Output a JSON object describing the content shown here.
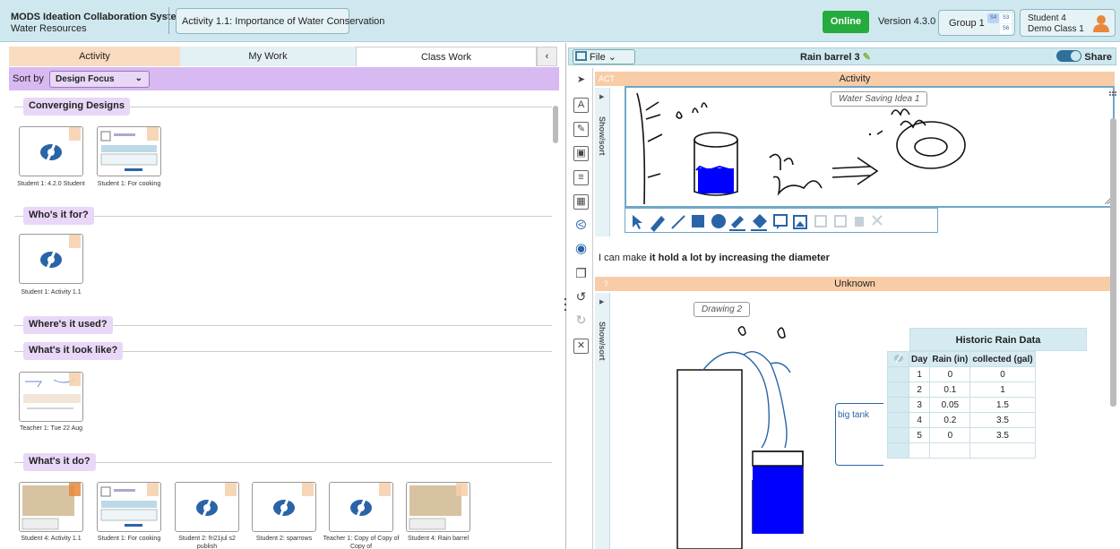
{
  "header": {
    "app_title": "MODS Ideation Collaboration System",
    "app_subtitle": "Water Resources",
    "activity": "Activity 1.1: Importance of Water Conservation",
    "status": "Online",
    "version": "Version 4.3.0",
    "group": "Group 1",
    "group_members": [
      "S4",
      "S3",
      "S6"
    ],
    "user_name": "Student 4",
    "user_class": "Demo Class 1"
  },
  "left": {
    "tabs": [
      "Activity",
      "My Work",
      "Class Work"
    ],
    "collapse": "‹",
    "sort_label": "Sort by",
    "sort_value": "Design Focus",
    "sections": [
      {
        "title": "Converging Designs",
        "items": [
          "Student 1: 4.2.0 Student",
          "Student 1: For cooking"
        ]
      },
      {
        "title": "Who's it for?",
        "items": [
          "Student 1: Activity 1.1"
        ]
      },
      {
        "title": "Where's it used?",
        "items": []
      },
      {
        "title": "What's it look like?",
        "items": [
          "Teacher 1: Tue 22 Aug"
        ]
      },
      {
        "title": "What's it do?",
        "items": [
          "Student 4: Activity 1.1",
          "Student 1: For cooking",
          "Student 2: fri21jul s2 publish",
          "Student 2: sparrows",
          "Teacher 1: Copy of Copy of Copy of",
          "Student 4: Rain barrel"
        ]
      }
    ]
  },
  "right": {
    "file_menu": "File",
    "doc_title": "Rain barrel 3",
    "share_label": "Share",
    "banner1_tag": "ACT",
    "banner1": "Activity",
    "show_sort": "Show/sort",
    "drawing1_label": "Water Saving Idea 1",
    "drawing1_handwriting": [
      "rain",
      "barrel",
      "dishes"
    ],
    "text_plain": "I can make ",
    "text_bold": "it hold a lot by increasing the diameter",
    "banner2_tag": "?",
    "banner2": "Unknown",
    "drawing2_label": "Drawing 2",
    "drawing2_note": "big tank",
    "table": {
      "title": "Historic Rain Data",
      "headers": [
        "Day",
        "Rain (in)",
        "collected (gal)"
      ],
      "rows": [
        [
          "1",
          "0",
          "0"
        ],
        [
          "2",
          "0.1",
          "1"
        ],
        [
          "3",
          "0.05",
          "1.5"
        ],
        [
          "4",
          "0.2",
          "3.5"
        ],
        [
          "5",
          "0",
          "3.5"
        ]
      ]
    }
  },
  "colors": {
    "header_bg": "#cfe8ef",
    "online_green": "#26ab3d",
    "tab_activity": "#f9dcc0",
    "sort_bar": "#d8b9f2",
    "banner": "#f8cca7",
    "accent_blue": "#2a64a8",
    "fill_blue": "#0000ff"
  }
}
